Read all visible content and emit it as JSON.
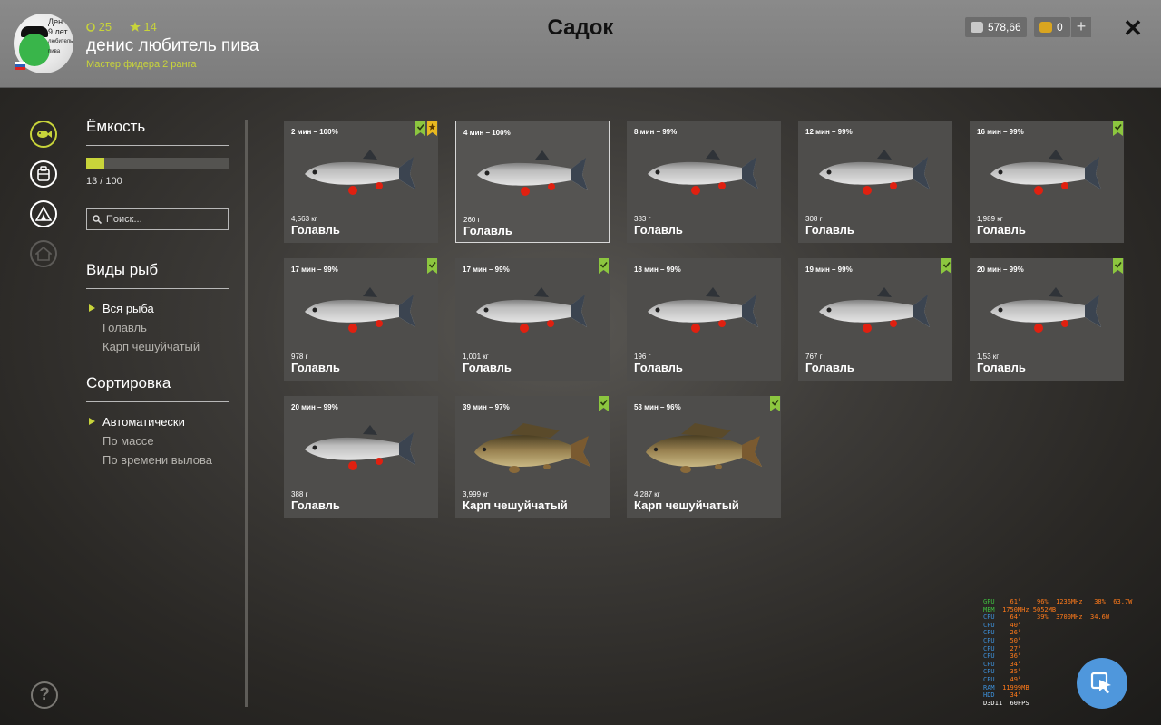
{
  "header": {
    "title": "Садок",
    "username": "денис любитель пива",
    "rank": "Мастер фидера 2 ранга",
    "level": "25",
    "stars": "14",
    "silver": "578,66",
    "gold": "0",
    "plus": "+",
    "close": "✕",
    "avatar_text": [
      "Ден",
      "9 лет",
      "любитель пива"
    ]
  },
  "sidebar": {
    "capacity_title": "Ёмкость",
    "capacity_count": "13 / 100",
    "capacity_fraction": 0.13,
    "search_placeholder": "Поиск...",
    "species_title": "Виды рыб",
    "species": [
      "Вся рыба",
      "Голавль",
      "Карп чешуйчатый"
    ],
    "sort_title": "Сортировка",
    "sort": [
      "Автоматически",
      "По массе",
      "По времени вылова"
    ]
  },
  "cards": [
    {
      "time": "2 мин – 100%",
      "weight": "4,563 кг",
      "name": "Голавль",
      "check": true,
      "star": true,
      "fish": "chub"
    },
    {
      "time": "4 мин – 100%",
      "weight": "260 г",
      "name": "Голавль",
      "check": false,
      "star": false,
      "fish": "chub"
    },
    {
      "time": "8 мин – 99%",
      "weight": "383 г",
      "name": "Голавль",
      "check": false,
      "star": false,
      "fish": "chub"
    },
    {
      "time": "12 мин – 99%",
      "weight": "308 г",
      "name": "Голавль",
      "check": false,
      "star": false,
      "fish": "chub"
    },
    {
      "time": "16 мин – 99%",
      "weight": "1,989 кг",
      "name": "Голавль",
      "check": true,
      "star": false,
      "fish": "chub"
    },
    {
      "time": "17 мин – 99%",
      "weight": "978 г",
      "name": "Голавль",
      "check": true,
      "star": false,
      "fish": "chub"
    },
    {
      "time": "17 мин – 99%",
      "weight": "1,001 кг",
      "name": "Голавль",
      "check": true,
      "star": false,
      "fish": "chub"
    },
    {
      "time": "18 мин – 99%",
      "weight": "196 г",
      "name": "Голавль",
      "check": false,
      "star": false,
      "fish": "chub"
    },
    {
      "time": "19 мин – 99%",
      "weight": "767 г",
      "name": "Голавль",
      "check": true,
      "star": false,
      "fish": "chub"
    },
    {
      "time": "20 мин – 99%",
      "weight": "1,53 кг",
      "name": "Голавль",
      "check": true,
      "star": false,
      "fish": "chub"
    },
    {
      "time": "20 мин – 99%",
      "weight": "388 г",
      "name": "Голавль",
      "check": false,
      "star": false,
      "fish": "chub"
    },
    {
      "time": "39 мин – 97%",
      "weight": "3,999 кг",
      "name": "Карп чешуйчатый",
      "check": true,
      "star": false,
      "fish": "carp"
    },
    {
      "time": "53 мин – 96%",
      "weight": "4,287 кг",
      "name": "Карп чешуйчатый",
      "check": true,
      "star": false,
      "fish": "carp"
    }
  ],
  "overlay_lines": [
    "GPU    61°    96%  1236MHz   38%  63.7W",
    "MEM  1750MHz 5052MB",
    "CPU    64°    39%  3700MHz  34.6W",
    "CPU    40°",
    "CPU    26°",
    "CPU    50°",
    "CPU    27°",
    "CPU    36°",
    "CPU    34°",
    "CPU    35°",
    "CPU    49°",
    "RAM  11999MB",
    "HDD    34°",
    "D3D11  60FPS"
  ],
  "colors": {
    "accent": "#c8d43a",
    "check_badge": "#8cc63f",
    "star_badge": "#e8b820",
    "fab": "#4f97dc"
  }
}
